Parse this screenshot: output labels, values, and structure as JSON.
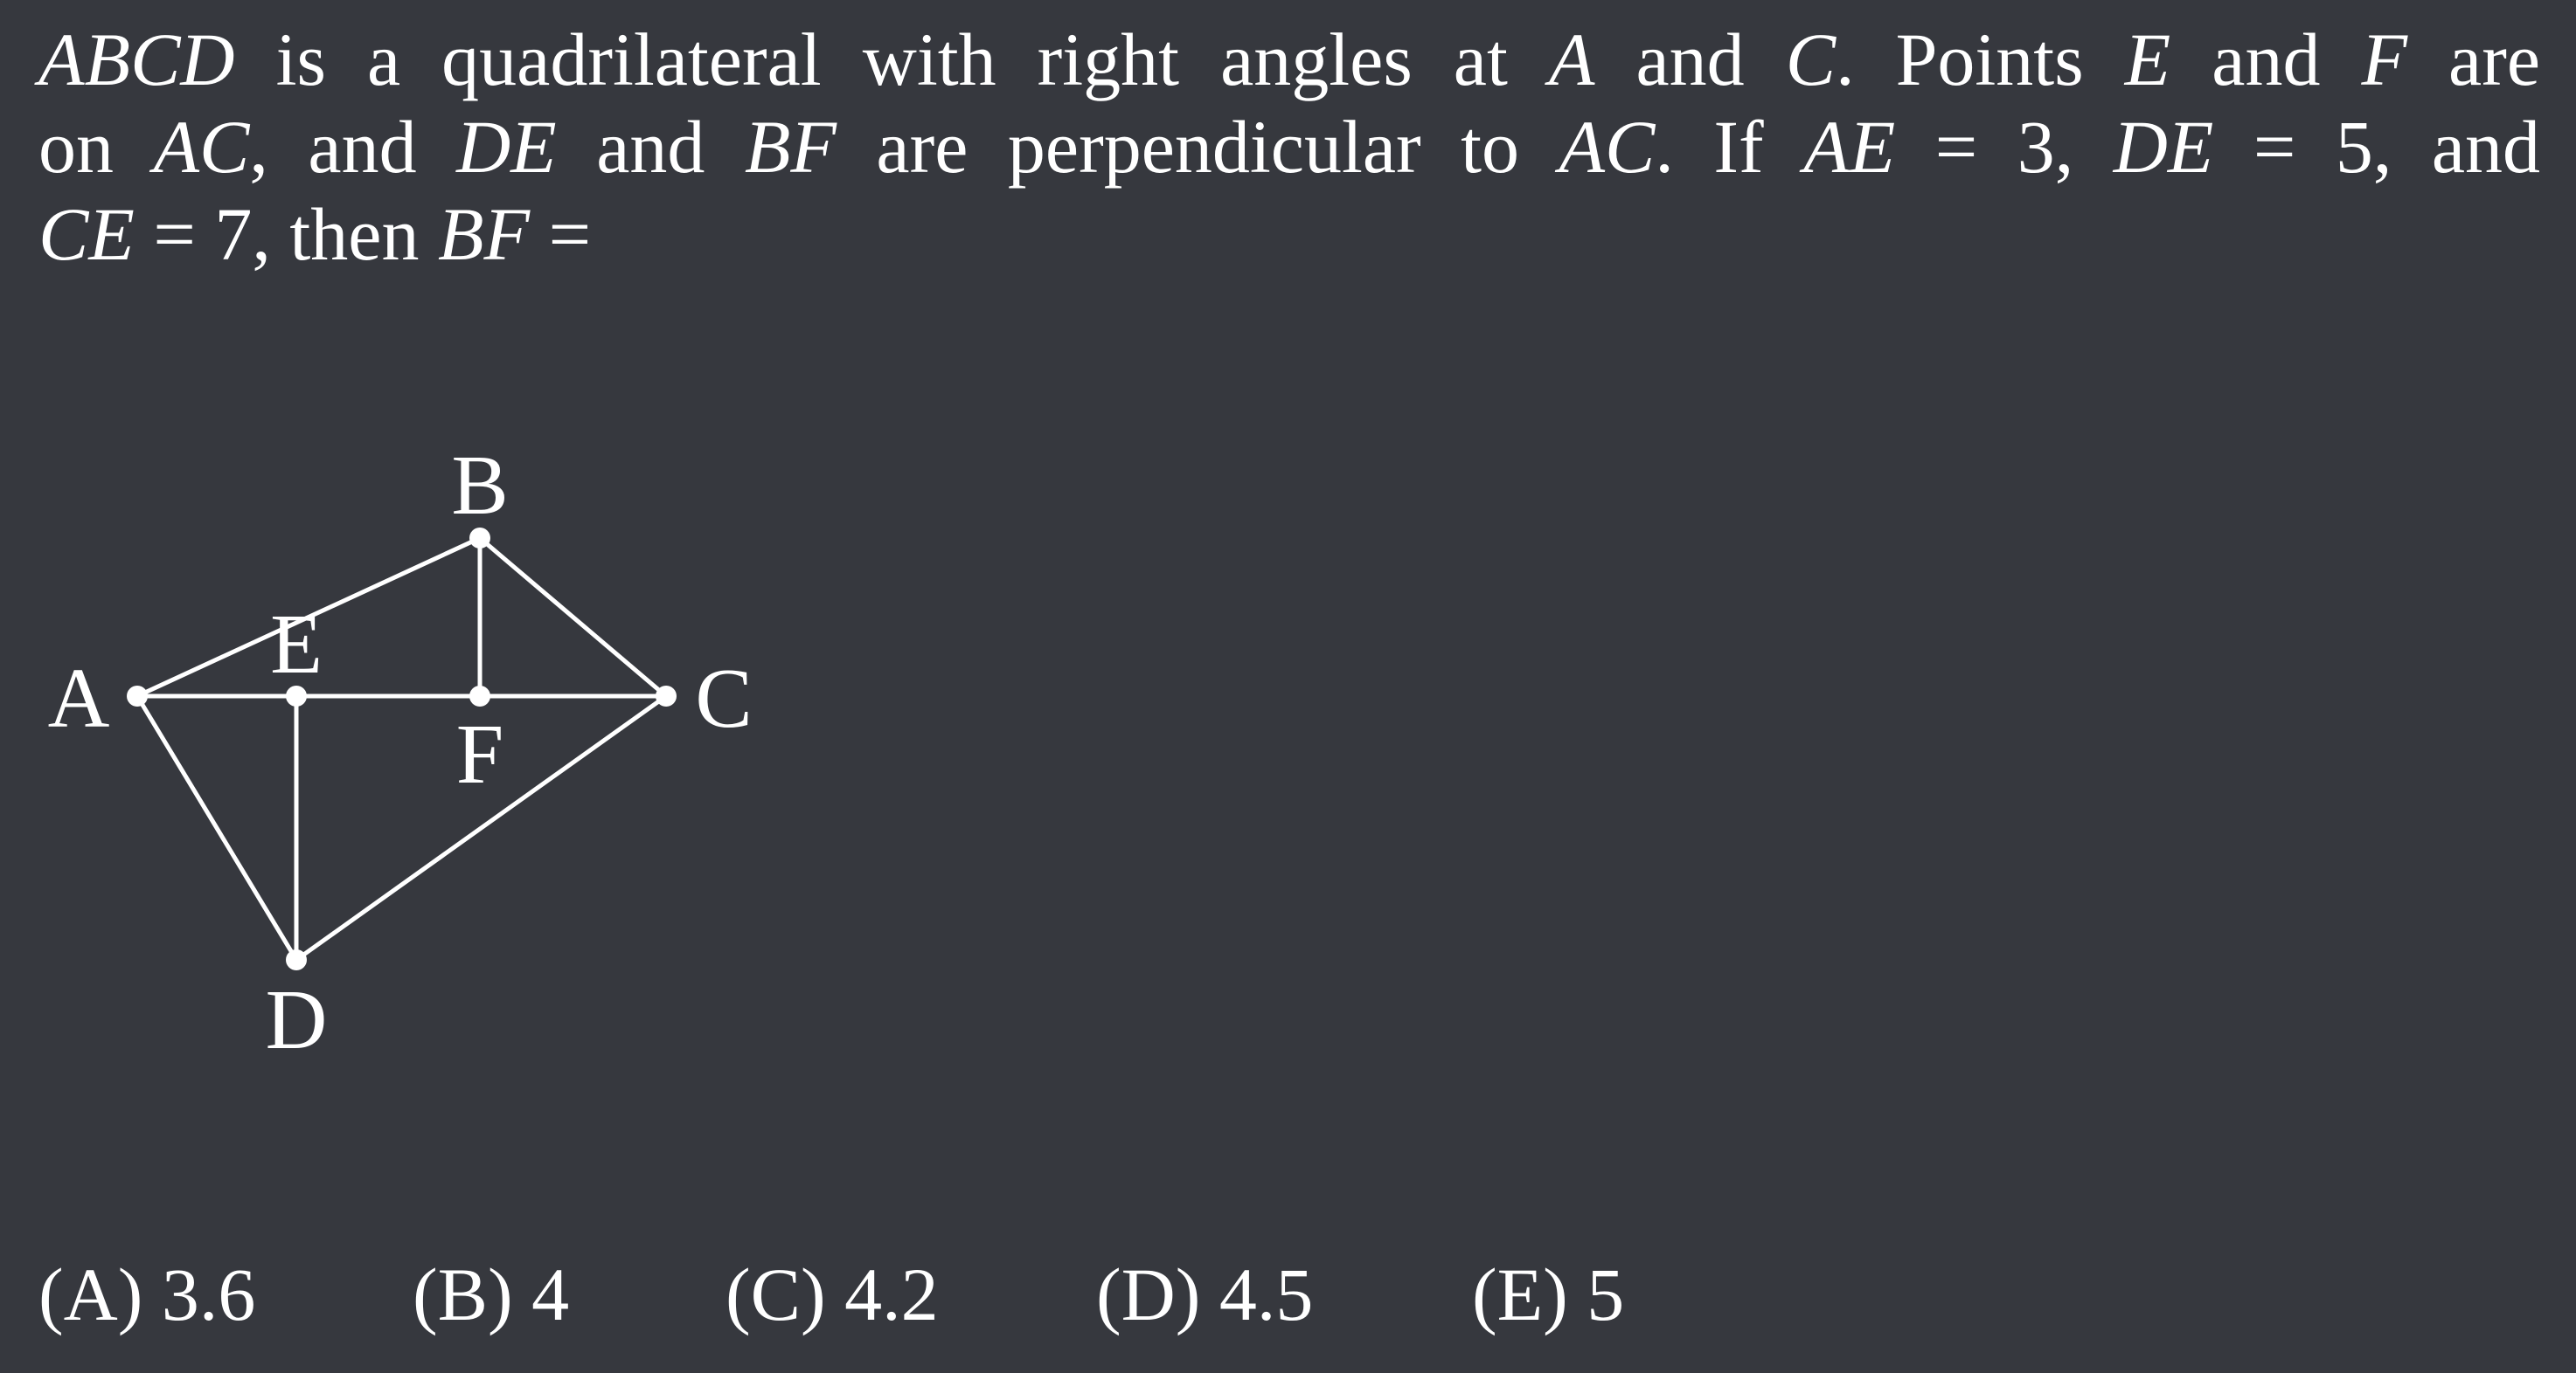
{
  "problem": {
    "line1": "ABCD is a quadrilateral with right angles at A and C. Points E and F are",
    "line2": "on AC, and DE and BF are perpendicular to AC. If AE = 3, DE = 5, and",
    "line3": "CE = 7, then BF ="
  },
  "diagram": {
    "labels": {
      "A": "A",
      "B": "B",
      "C": "C",
      "D": "D",
      "E": "E",
      "F": "F"
    },
    "colors": {
      "stroke": "#ffffff",
      "background": "#36383e"
    }
  },
  "answers": [
    "(A) 3.6",
    "(B) 4",
    "(C) 4.2",
    "(D) 4.5",
    "(E) 5"
  ]
}
